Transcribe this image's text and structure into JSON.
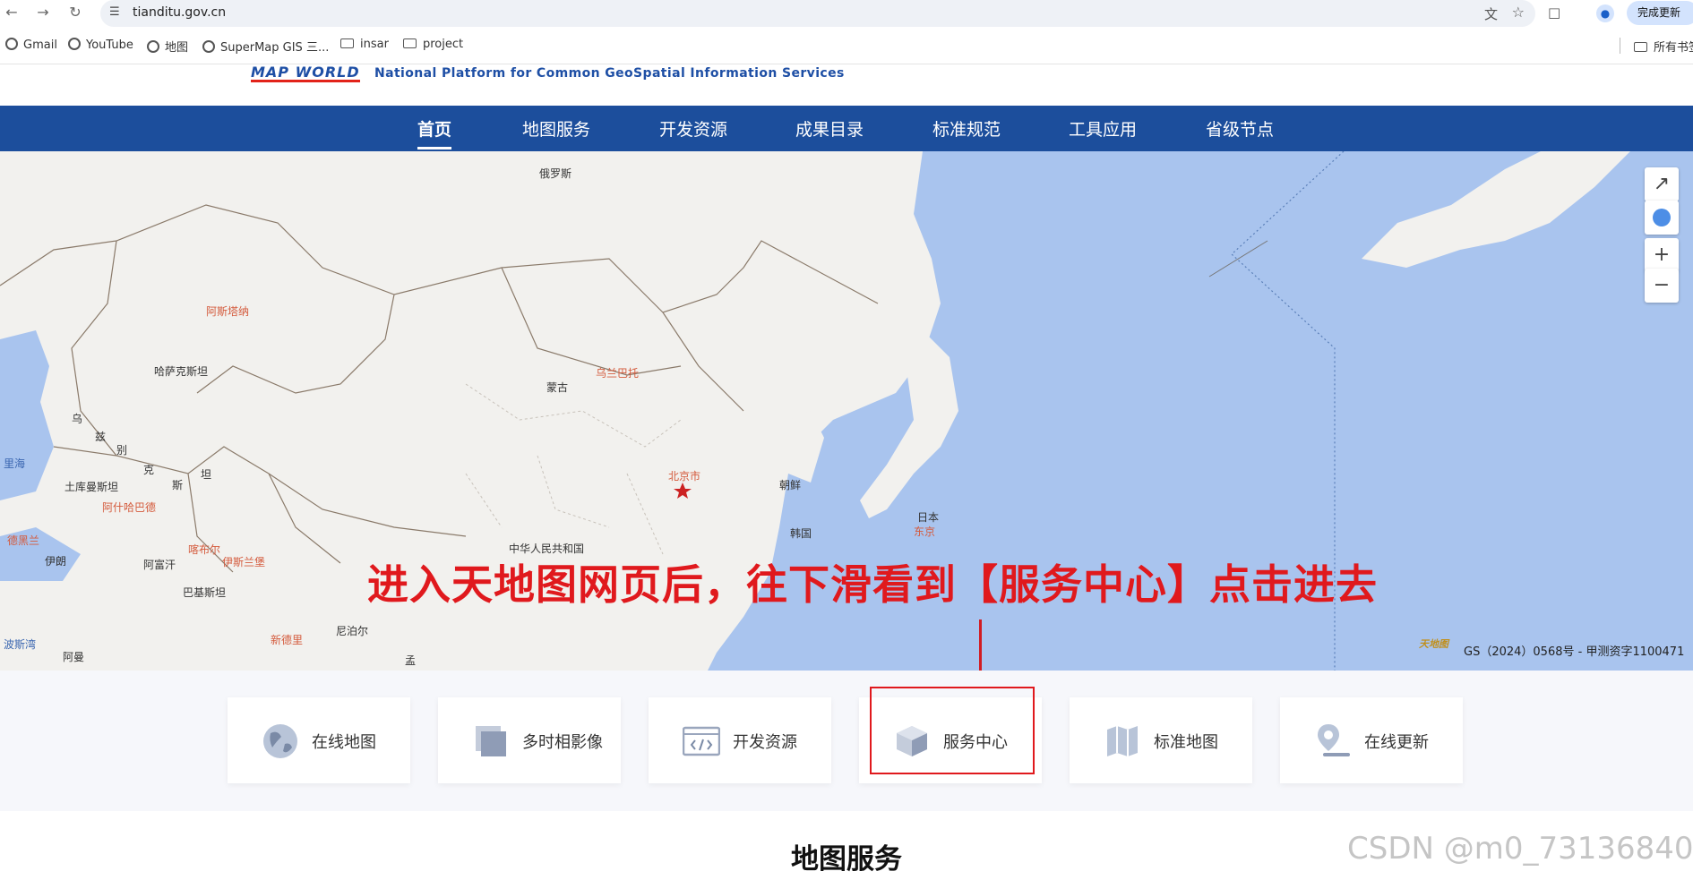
{
  "browser": {
    "url": "tianditu.gov.cn",
    "update_button": "完成更新",
    "bookmarks": [
      {
        "label": "Gmail",
        "icon": "globe-icon"
      },
      {
        "label": "YouTube",
        "icon": "globe-icon"
      },
      {
        "label": "地图",
        "icon": "globe-icon"
      },
      {
        "label": "SuperMap GIS 三...",
        "icon": "globe-icon"
      },
      {
        "label": "insar",
        "icon": "folder-icon"
      },
      {
        "label": "project",
        "icon": "folder-icon"
      }
    ],
    "all_bookmarks": "所有书签"
  },
  "site": {
    "logo": "MAP WORLD",
    "tagline": "National Platform for Common GeoSpatial Information Services",
    "nav": [
      "首页",
      "地图服务",
      "开发资源",
      "成果目录",
      "标准规范",
      "工具应用",
      "省级节点"
    ],
    "active_nav": "首页"
  },
  "map": {
    "labels": {
      "russia": "俄罗斯",
      "astana": "阿斯塔纳",
      "kazakhstan": "哈萨克斯坦",
      "mongolia": "蒙古",
      "ulaanbaatar": "乌兰巴托",
      "uzbek_1": "乌",
      "uzbek_2": "兹",
      "uzbek_3": "别",
      "uzbek_4": "克",
      "caspian": "里海",
      "turkmenistan": "土库曼斯坦",
      "ashgabat": "阿什哈巴德",
      "tajik": "斯",
      "tajik2": "坦",
      "tehran": "德黑兰",
      "iran": "伊朗",
      "afghanistan": "阿富汗",
      "kabul": "喀布尔",
      "islamabad": "伊斯兰堡",
      "pakistan": "巴基斯坦",
      "nepal": "尼泊尔",
      "new_delhi": "新德里",
      "persian_gulf": "波斯湾",
      "oman": "阿曼",
      "india": "孟",
      "beijing": "北京市",
      "prc": "中华人民共和国",
      "nk": "朝鲜",
      "sk": "韩国",
      "japan": "日本",
      "tokyo": "东京"
    },
    "copyright_logo": "天地图",
    "copyright": "GS（2024）0568号 - 甲测资字1100471",
    "controls": [
      "fullscreen-icon",
      "globe-icon",
      "zoom-in-icon",
      "zoom-out-icon"
    ]
  },
  "annotation": "进入天地图网页后，往下滑看到【服务中心】点击进去",
  "quick_links": [
    {
      "label": "在线地图",
      "icon": "globe-icon"
    },
    {
      "label": "多时相影像",
      "icon": "layers-icon"
    },
    {
      "label": "开发资源",
      "icon": "code-icon"
    },
    {
      "label": "服务中心",
      "icon": "cube-icon"
    },
    {
      "label": "标准地图",
      "icon": "folded-map-icon"
    },
    {
      "label": "在线更新",
      "icon": "location-pin-icon"
    }
  ],
  "section_title": "地图服务",
  "watermark": "CSDN @m0_73136840"
}
